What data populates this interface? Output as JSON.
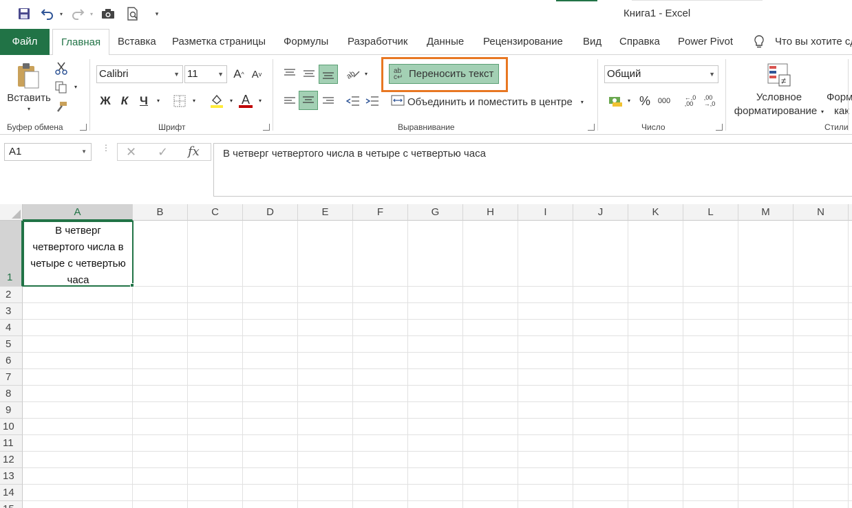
{
  "window": {
    "title": "Книга1  -  Excel"
  },
  "qat": {
    "save": "save-icon",
    "undo": "undo-icon",
    "redo": "redo-icon",
    "camera": "camera-icon",
    "preview": "print-preview-icon",
    "customize": "▾"
  },
  "tabs": [
    {
      "label": "Файл"
    },
    {
      "label": "Главная"
    },
    {
      "label": "Вставка"
    },
    {
      "label": "Разметка страницы"
    },
    {
      "label": "Формулы"
    },
    {
      "label": "Разработчик"
    },
    {
      "label": "Данные"
    },
    {
      "label": "Рецензирование"
    },
    {
      "label": "Вид"
    },
    {
      "label": "Справка"
    },
    {
      "label": "Power Pivot"
    },
    {
      "label": "Что вы хотите сд"
    }
  ],
  "ribbon": {
    "clipboard": {
      "paste_label": "Вставить",
      "group_label": "Буфер обмена"
    },
    "font": {
      "name": "Calibri",
      "size": "11",
      "bold": "Ж",
      "italic": "К",
      "underline": "Ч",
      "grow": "A",
      "shrink": "A",
      "color_letter": "A",
      "group_label": "Шрифт"
    },
    "alignment": {
      "wrap_text": "Переносить текст",
      "merge_center": "Объединить и поместить в центре",
      "group_label": "Выравнивание"
    },
    "number": {
      "format": "Общий",
      "percent": "%",
      "thousands": "000",
      "group_label": "Число"
    },
    "styles": {
      "conditional_line1": "Условное",
      "conditional_line2": "форматирование",
      "format_as_line1": "Форм",
      "format_as_line2": "как",
      "group_label": "Стили"
    },
    "colors": {
      "accent": "#217346",
      "highlight": "#e87722",
      "fill": "#ffeb3b",
      "font_color": "#c00000"
    }
  },
  "formula_bar": {
    "name_box": "A1",
    "cancel": "✕",
    "enter": "✓",
    "fx": "fx",
    "content": "В четверг четвертого числа в четыре с четвертью часа"
  },
  "sheet": {
    "columns": [
      "A",
      "B",
      "C",
      "D",
      "E",
      "F",
      "G",
      "H",
      "I",
      "J",
      "K",
      "L",
      "M",
      "N"
    ],
    "rows": [
      "1",
      "2",
      "3",
      "4",
      "5",
      "6",
      "7",
      "8",
      "9",
      "10",
      "11",
      "12",
      "13",
      "14",
      "15"
    ],
    "cell_a1_lines": [
      "В четверг",
      "четвертого числа в",
      "четыре с четвертью",
      "часа"
    ]
  }
}
